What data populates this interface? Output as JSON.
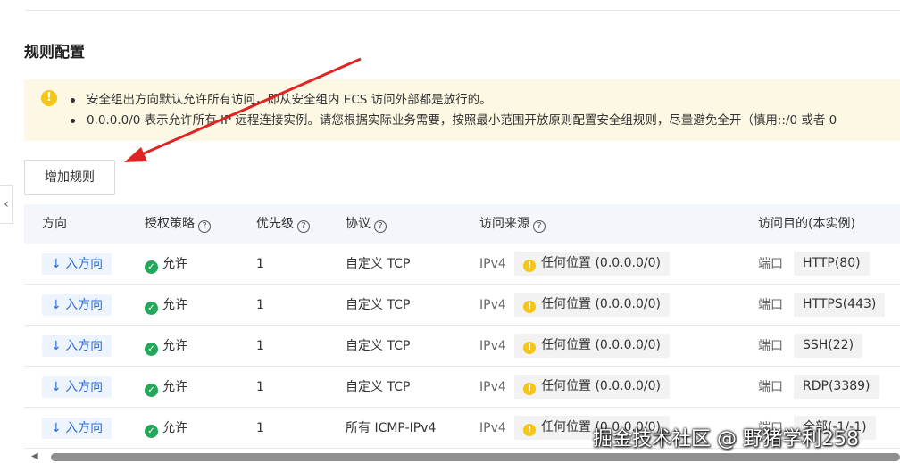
{
  "section": {
    "title": "规则配置"
  },
  "notice": {
    "lines": [
      "安全组出方向默认允许所有访问，即从安全组内 ECS 访问外部都是放行的。",
      "0.0.0.0/0 表示允许所有 IP 远程连接实例。请您根据实际业务需要，按照最小范围开放原则配置安全组规则，尽量避免全开（慎用::/0 或者 0"
    ]
  },
  "toolbar": {
    "add_rule_label": "增加规则"
  },
  "collapse_glyph": "‹",
  "table": {
    "headers": {
      "direction": "方向",
      "policy": "授权策略",
      "priority": "优先级",
      "protocol": "协议",
      "source": "访问来源",
      "destination": "访问目的(本实例)"
    },
    "help_glyph": "?",
    "rows": [
      {
        "direction": "↓ 入方向",
        "policy": "允许",
        "priority": "1",
        "protocol": "自定义 TCP",
        "ip_version": "IPv4",
        "source": "任何位置 (0.0.0.0/0)",
        "port_label": "端口",
        "port": "HTTP(80)"
      },
      {
        "direction": "↓ 入方向",
        "policy": "允许",
        "priority": "1",
        "protocol": "自定义 TCP",
        "ip_version": "IPv4",
        "source": "任何位置 (0.0.0.0/0)",
        "port_label": "端口",
        "port": "HTTPS(443)"
      },
      {
        "direction": "↓ 入方向",
        "policy": "允许",
        "priority": "1",
        "protocol": "自定义 TCP",
        "ip_version": "IPv4",
        "source": "任何位置 (0.0.0.0/0)",
        "port_label": "端口",
        "port": "SSH(22)"
      },
      {
        "direction": "↓ 入方向",
        "policy": "允许",
        "priority": "1",
        "protocol": "自定义 TCP",
        "ip_version": "IPv4",
        "source": "任何位置 (0.0.0.0/0)",
        "port_label": "端口",
        "port": "RDP(3389)"
      },
      {
        "direction": "↓ 入方向",
        "policy": "允许",
        "priority": "1",
        "protocol": "所有 ICMP-IPv4",
        "ip_version": "IPv4",
        "source": "任何位置 (0.0.0.0/0)",
        "port_label": "端口",
        "port": "全部(-1/-1)"
      }
    ]
  },
  "watermark": "掘金技术社区 @ 野猪学利258",
  "colors": {
    "accent_blue": "#2f6fd6",
    "allow_green": "#25a65b",
    "warning_yellow": "#f5c518",
    "annotation_red": "#e02424",
    "notice_bg": "#fdf8e3"
  }
}
